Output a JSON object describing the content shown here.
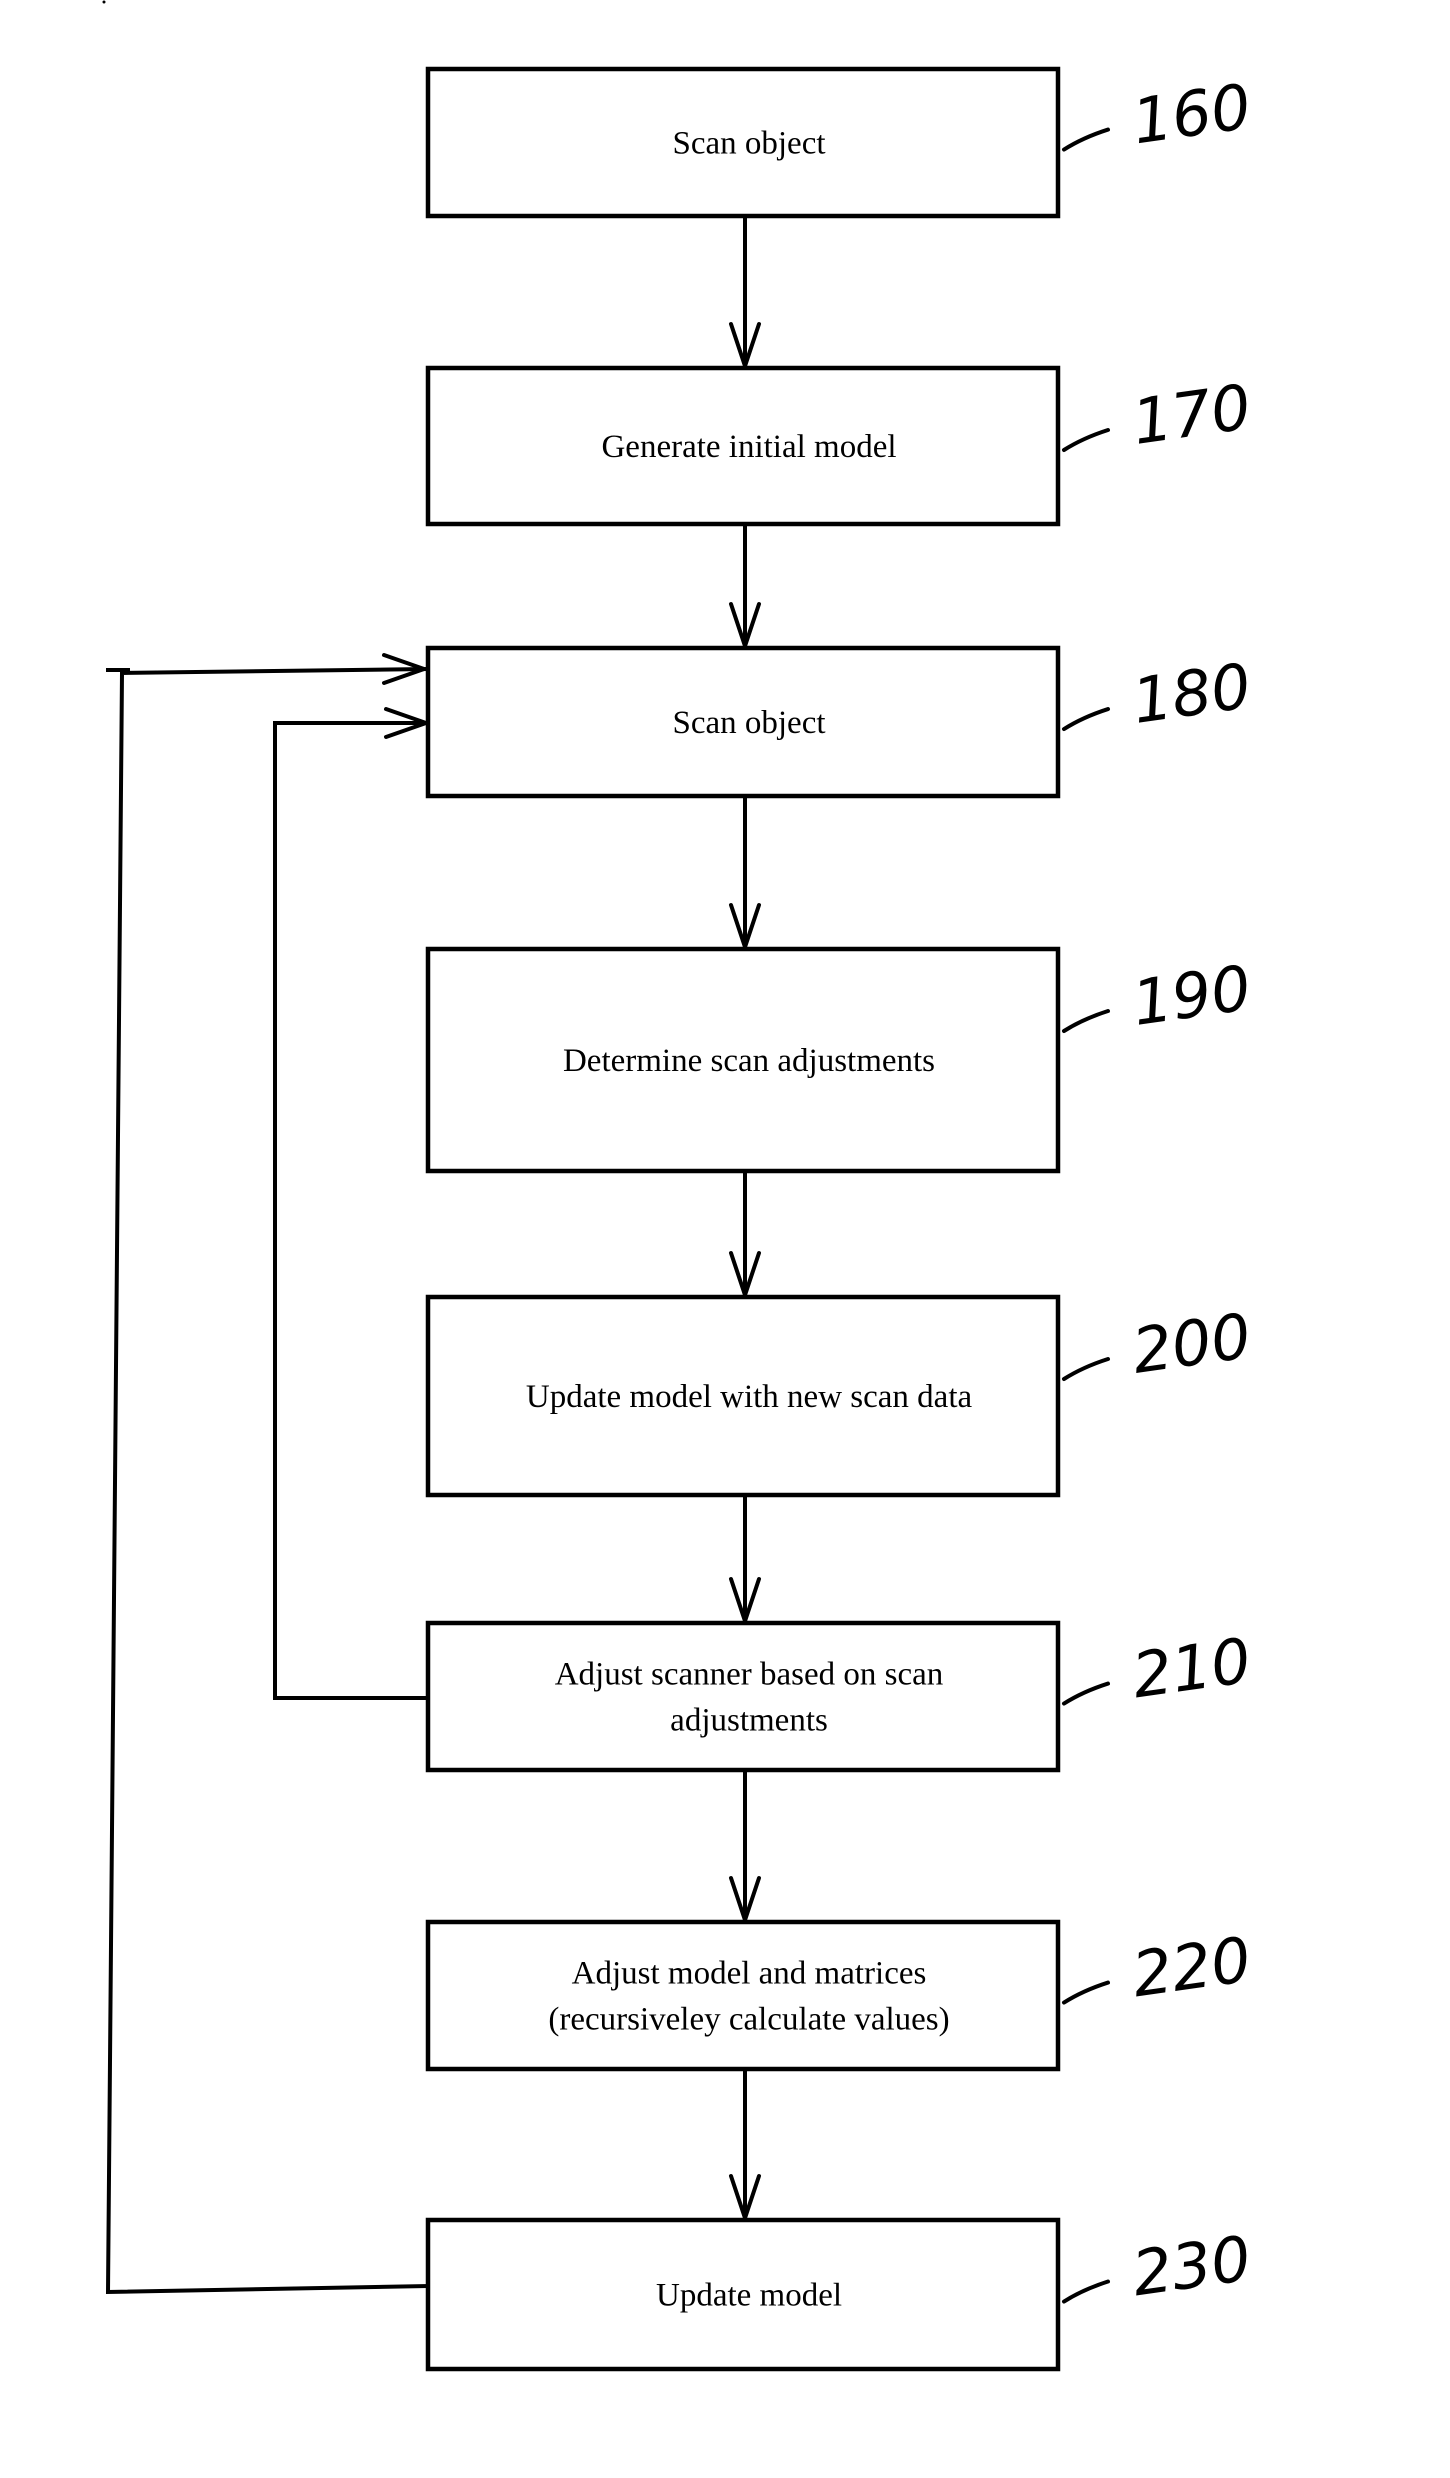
{
  "diagram": {
    "type": "flowchart",
    "colors": {
      "stroke": "#000000",
      "background": "#ffffff"
    },
    "steps": [
      {
        "id": "160",
        "ref": "160",
        "lines": [
          "Scan object"
        ]
      },
      {
        "id": "170",
        "ref": "170",
        "lines": [
          "Generate initial model"
        ]
      },
      {
        "id": "180",
        "ref": "180",
        "lines": [
          "Scan object"
        ]
      },
      {
        "id": "190",
        "ref": "190",
        "lines": [
          "Determine scan adjustments"
        ]
      },
      {
        "id": "200",
        "ref": "200",
        "lines": [
          "Update model with new scan data"
        ]
      },
      {
        "id": "210",
        "ref": "210",
        "lines": [
          "Adjust scanner based on scan",
          "adjustments"
        ]
      },
      {
        "id": "220",
        "ref": "220",
        "lines": [
          "Adjust model and matrices",
          "(recursiveley calculate values)"
        ]
      },
      {
        "id": "230",
        "ref": "230",
        "lines": [
          "Update model"
        ]
      }
    ],
    "edges": [
      {
        "from": "160",
        "to": "170",
        "kind": "down"
      },
      {
        "from": "170",
        "to": "180",
        "kind": "down"
      },
      {
        "from": "180",
        "to": "190",
        "kind": "down"
      },
      {
        "from": "190",
        "to": "200",
        "kind": "down"
      },
      {
        "from": "200",
        "to": "210",
        "kind": "down"
      },
      {
        "from": "210",
        "to": "220",
        "kind": "down"
      },
      {
        "from": "220",
        "to": "230",
        "kind": "down"
      },
      {
        "from": "210",
        "to": "180",
        "kind": "feedback-inner"
      },
      {
        "from": "230",
        "to": "180",
        "kind": "feedback-outer"
      }
    ]
  }
}
